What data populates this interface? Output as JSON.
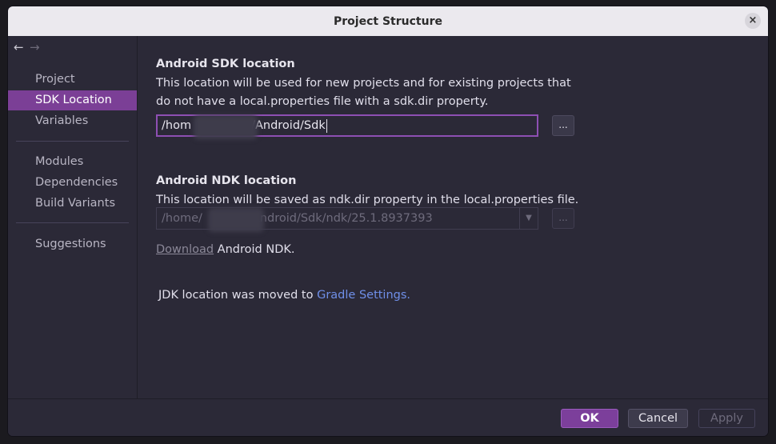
{
  "window": {
    "title": "Project Structure",
    "close_glyph": "×"
  },
  "nav": {
    "back_glyph": "←",
    "forward_glyph": "→"
  },
  "sidebar": {
    "items": [
      {
        "label": "Project"
      },
      {
        "label": "SDK Location",
        "selected": true
      },
      {
        "label": "Variables"
      },
      {
        "label": "Modules"
      },
      {
        "label": "Dependencies"
      },
      {
        "label": "Build Variants"
      },
      {
        "label": "Suggestions"
      }
    ]
  },
  "sdk": {
    "heading": "Android SDK location",
    "desc_line1": "This location will be used for new projects and for existing projects that",
    "desc_line2": "do not have a local.properties file with a sdk.dir property.",
    "path_prefix": "/hom",
    "path_suffix": "/Android/Sdk",
    "browse_label": "..."
  },
  "ndk": {
    "heading": "Android NDK location",
    "desc": "This location will be saved as ndk.dir property in the local.properties file.",
    "path_prefix": "/home/",
    "path_suffix": "Android/Sdk/ndk/25.1.8937393",
    "dropdown_glyph": "▼",
    "browse_label": "...",
    "download_link": "Download",
    "download_suffix": " Android NDK."
  },
  "jdk": {
    "text": "JDK location was moved to ",
    "link": "Gradle Settings."
  },
  "footer": {
    "ok": "OK",
    "cancel": "Cancel",
    "apply": "Apply"
  },
  "colors": {
    "accent": "#7b3f96",
    "link": "#6f8fe8",
    "background": "#2b2937"
  }
}
